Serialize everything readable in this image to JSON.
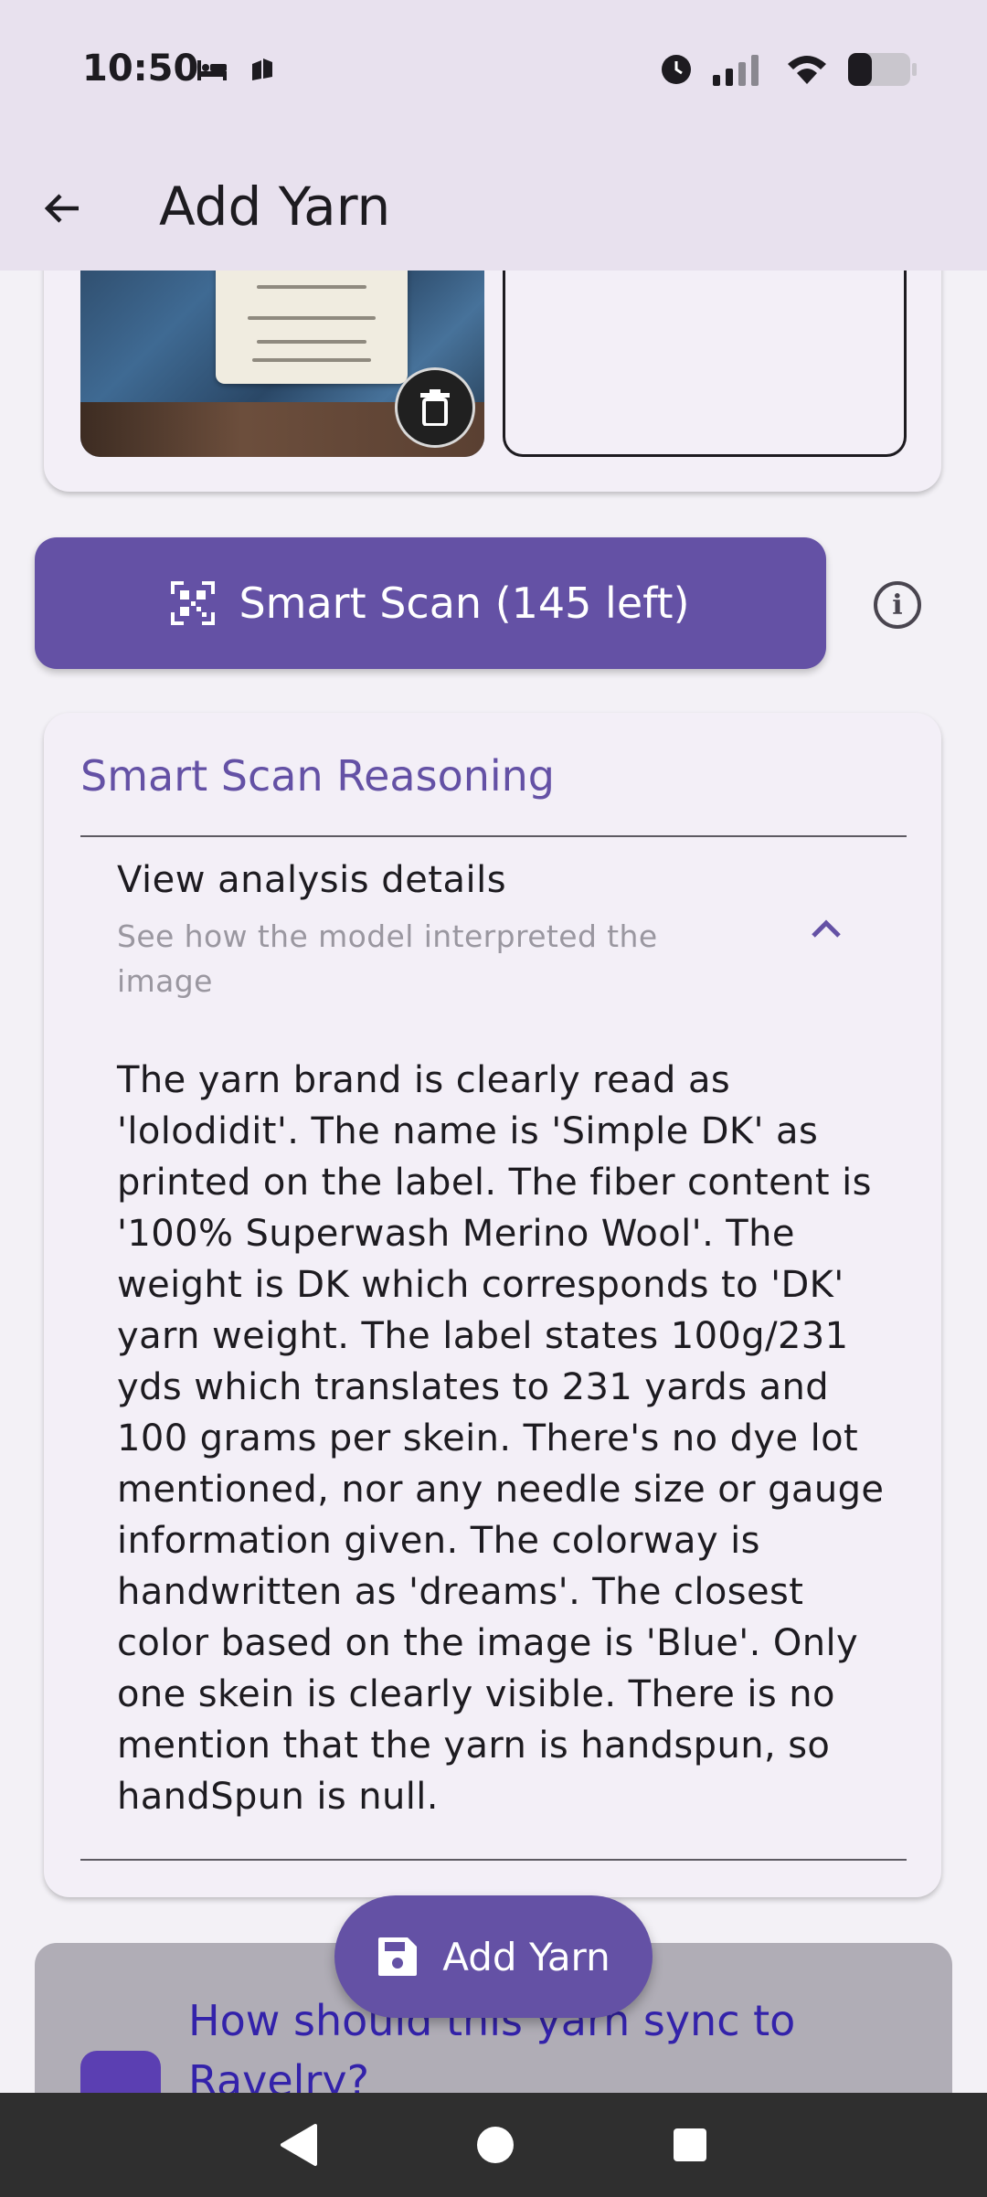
{
  "status_bar": {
    "time": "10:50"
  },
  "app_bar": {
    "title": "Add Yarn"
  },
  "smart_scan": {
    "label": "Smart Scan (145 left)"
  },
  "reasoning": {
    "title": "Smart Scan Reasoning",
    "details_title": "View analysis details",
    "details_subtitle": "See how the model interpreted the image",
    "body": "The yarn brand is clearly read as 'lolodidit'. The name is 'Simple DK' as printed on the label. The fiber content is '100% Superwash Merino Wool'. The weight is DK which corresponds to 'DK' yarn weight. The label states 100g/231 yds which translates to 231 yards and 100 grams per skein. There's no dye lot mentioned, nor any needle size or gauge information given. The colorway is handwritten as 'dreams'. The closest color based on the image is 'Blue'. Only one skein is clearly visible. There is no mention that the yarn is handspun, so handSpun is null."
  },
  "sync": {
    "title": "How should this yarn sync to Ravelry?"
  },
  "fab": {
    "label": "Add Yarn"
  },
  "colors": {
    "primary": "#6451a5",
    "app_bar": "#e8e1ee",
    "background": "#f3f1f6"
  }
}
